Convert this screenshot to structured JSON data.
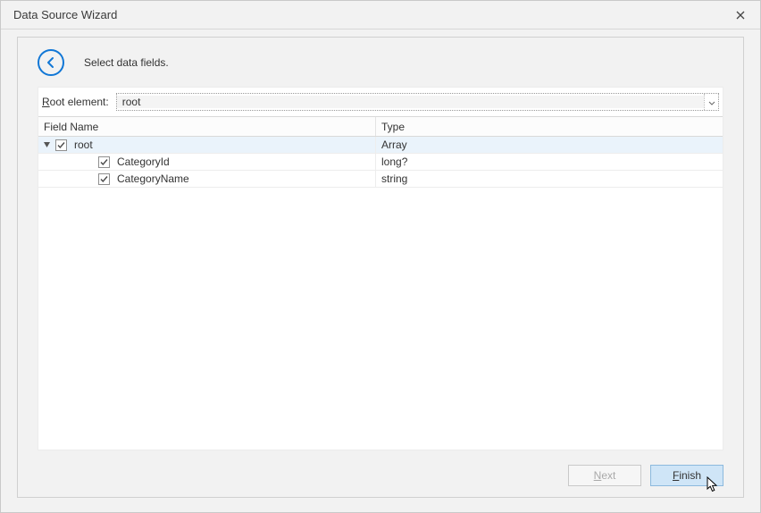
{
  "window": {
    "title": "Data Source Wizard"
  },
  "header": {
    "instruction": "Select data fields."
  },
  "root_selector": {
    "label_prefix": "R",
    "label_rest": "oot element:",
    "value": "root"
  },
  "grid": {
    "columns": {
      "name": "Field Name",
      "type": "Type"
    },
    "rows": [
      {
        "name": "root",
        "type": "Array",
        "checked": true,
        "level": 0,
        "expandable": true,
        "expanded": true,
        "selected": true
      },
      {
        "name": "CategoryId",
        "type": "long?",
        "checked": true,
        "level": 1,
        "expandable": false
      },
      {
        "name": "CategoryName",
        "type": "string",
        "checked": true,
        "level": 1,
        "expandable": false
      }
    ]
  },
  "buttons": {
    "next_u": "N",
    "next_rest": "ext",
    "finish_u": "F",
    "finish_rest": "inish"
  }
}
